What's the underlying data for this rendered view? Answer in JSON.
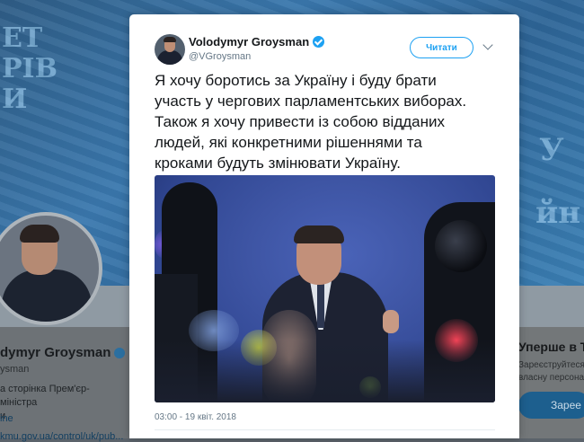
{
  "background_profile": {
    "banner_text_lines": [
      "ЕТ",
      "РІВ",
      "И"
    ],
    "banner_text_right": [
      "У",
      "йн"
    ],
    "name": "dymyr Groysman",
    "handle": "ysman",
    "bio_line1": "а сторінка Прем'єр-міністра",
    "bio_line2": "и",
    "link_line1": "ine",
    "link_line2": "kmu.gov.ua/control/uk/pub..."
  },
  "sidebar_card": {
    "title": "Уперше в Т",
    "subtitle_line1": "Зареєструйтеся з",
    "subtitle_line2": "власну персонал",
    "button_label": "Зарее"
  },
  "tweet": {
    "author_name": "Volodymyr Groysman",
    "author_handle": "@VGroysman",
    "follow_button_label": "Читати",
    "text": "Я хочу боротись за Україну і буду брати\nучасть у чергових парламентських виборах.\nТакож я хочу привести із собою відданих\nлюдей, які конкретними рішеннями та\nкроками будуть змінювати Україну.",
    "timestamp": "03:00 - 19 квіт. 2018"
  },
  "icons": {
    "verified": "verified-badge-icon",
    "more": "chevron-down-icon"
  },
  "colors": {
    "accent": "#1da1f2",
    "text": "#14171a",
    "muted": "#657786"
  }
}
